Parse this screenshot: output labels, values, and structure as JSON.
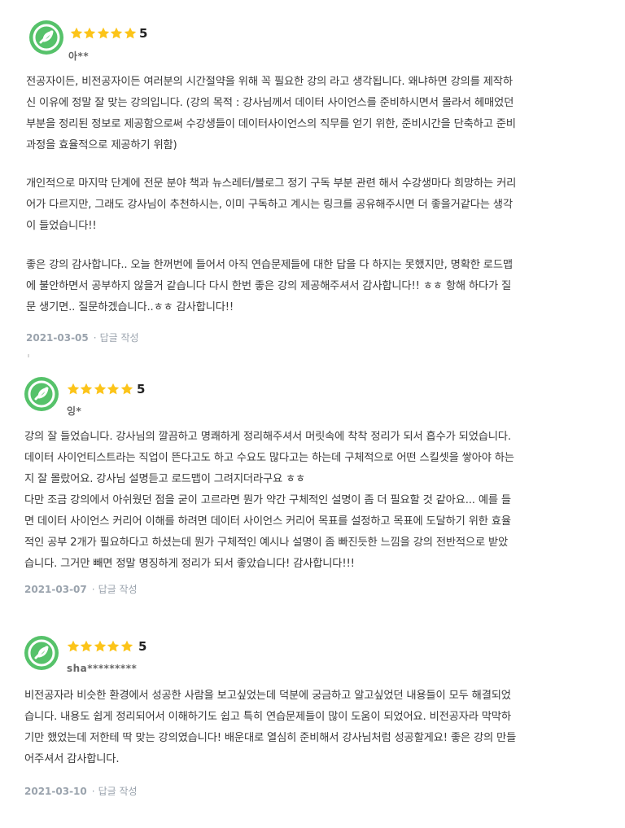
{
  "colors": {
    "accent": "#56c26a",
    "star": "#fcc419",
    "meta": "#9aa3ad"
  },
  "reviews": [
    {
      "rating": "5",
      "stars": 5,
      "author": "아**",
      "paragraphs": [
        "전공자이든, 비전공자이든 여러분의 시간절약을 위해 꼭 필요한 강의 라고 생각됩니다. 왜냐하면 강의를 제작하\n신 이유에 정말 잘 맞는 강의입니다. (강의 목적 : 강사님께서 데이터 사이언스를 준비하시면서 몰라서 헤매었던\n부분을 정리된 정보로 제공함으로써 수강생들이 데이터사이언스의 직무를 얻기 위한, 준비시간을 단축하고 준비\n과정을 효율적으로 제공하기 위함)",
        "개인적으로 마지막 단계에 전문 분야 책과 뉴스레터/블로그 정기 구독 부분 관련 해서 수강생마다 희망하는 커리\n어가 다르지만, 그래도 강사님이 추천하시는, 이미 구독하고 계시는 링크를 공유해주시면 더 좋을거같다는 생각\n이 들었습니다!!",
        "좋은 강의 감사합니다.. 오늘 한꺼번에 들어서 아직 연습문제들에 대한 답을 다 하지는 못했지만, 명확한 로드맵\n에 불안하면서 공부하지 않을거 같습니다 다시 한번 좋은 강의 제공해주셔서 감사합니다!! ㅎㅎ 항해 하다가 질\n문 생기면.. 질문하겠습니다..ㅎㅎ 감사합니다!!"
      ],
      "date": "2021-03-05",
      "reply_label": "답글 작성"
    },
    {
      "rating": "5",
      "stars": 5,
      "author": "잉*",
      "paragraphs": [
        "강의 잘 들었습니다. 강사님의 깔끔하고 명쾌하게 정리해주셔서 머릿속에 착착 정리가 되서 흡수가 되었습니다.\n데이터 사이언티스트라는 직업이 뜬다고도 하고 수요도 많다고는 하는데 구체적으로 어떤 스킬셋을 쌓아야 하는\n지 잘 몰랐어요. 강사님 설명듣고 로드맵이 그려지더라구요 ㅎㅎ\n다만 조금 강의에서 아쉬웠던 점을 굳이 고르라면 뭔가 약간 구체적인 설명이 좀 더 필요할 것 같아요... 예를 들\n면 데이터 사이언스 커리어 이해를 하려면 데이터 사이언스 커리어 목표를 설정하고 목표에 도달하기 위한 효율\n적인 공부 2개가 필요하다고 하셨는데 뭔가 구체적인 예시나 설명이 좀 빠진듯한 느낌을 강의 전반적으로 받았\n습니다. 그거만 빼면 정말 명징하게 정리가 되서 좋았습니다! 감사합니다!!!"
      ],
      "date": "2021-03-07",
      "reply_label": "답글 작성"
    },
    {
      "rating": "5",
      "stars": 5,
      "author": "sha*********",
      "paragraphs": [
        "비전공자라 비슷한 환경에서 성공한 사람을 보고싶었는데 덕분에 궁금하고 알고싶었던 내용들이 모두 해결되었\n습니다.  내용도 쉽게 정리되어서 이해하기도 쉽고 특히 연습문제들이 많이 도움이 되었어요. 비전공자라 막막하\n기만 했었는데 저한테 딱 맞는 강의였습니다! 배운대로 열심히 준비해서 강사님처럼 성공할게요! 좋은 강의 만들\n어주셔서 감사합니다."
      ],
      "date": "2021-03-10",
      "reply_label": "답글 작성"
    }
  ]
}
